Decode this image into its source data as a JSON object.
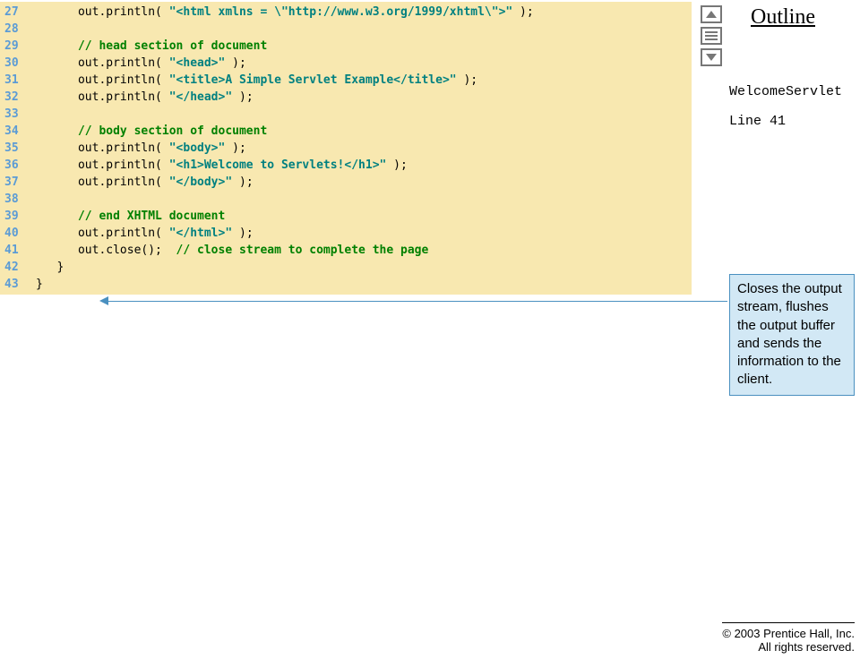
{
  "outline": {
    "title": "Outline",
    "class_name": "WelcomeServlet",
    "line_ref": "Line 41"
  },
  "callout": {
    "text": "Closes the output stream, flushes the output buffer and sends the information to the client."
  },
  "footer": {
    "line1": "© 2003 Prentice Hall, Inc.",
    "line2": "All rights reserved."
  },
  "code": {
    "lines": [
      {
        "n": "27",
        "seg": [
          {
            "c": "pln",
            "t": "      out.println( "
          },
          {
            "c": "str",
            "t": "\"<html xmlns = \\\"http://www.w3.org/1999/xhtml\\\">\""
          },
          {
            "c": "pln",
            "t": " );"
          }
        ]
      },
      {
        "n": "28",
        "seg": []
      },
      {
        "n": "29",
        "seg": [
          {
            "c": "pln",
            "t": "      "
          },
          {
            "c": "cmt",
            "t": "// head section of document"
          }
        ]
      },
      {
        "n": "30",
        "seg": [
          {
            "c": "pln",
            "t": "      out.println( "
          },
          {
            "c": "str",
            "t": "\"<head>\""
          },
          {
            "c": "pln",
            "t": " );"
          }
        ]
      },
      {
        "n": "31",
        "seg": [
          {
            "c": "pln",
            "t": "      out.println( "
          },
          {
            "c": "str",
            "t": "\"<title>A Simple Servlet Example</title>\""
          },
          {
            "c": "pln",
            "t": " );"
          }
        ]
      },
      {
        "n": "32",
        "seg": [
          {
            "c": "pln",
            "t": "      out.println( "
          },
          {
            "c": "str",
            "t": "\"</head>\""
          },
          {
            "c": "pln",
            "t": " );"
          }
        ]
      },
      {
        "n": "33",
        "seg": []
      },
      {
        "n": "34",
        "seg": [
          {
            "c": "pln",
            "t": "      "
          },
          {
            "c": "cmt",
            "t": "// body section of document"
          }
        ]
      },
      {
        "n": "35",
        "seg": [
          {
            "c": "pln",
            "t": "      out.println( "
          },
          {
            "c": "str",
            "t": "\"<body>\""
          },
          {
            "c": "pln",
            "t": " );"
          }
        ]
      },
      {
        "n": "36",
        "seg": [
          {
            "c": "pln",
            "t": "      out.println( "
          },
          {
            "c": "str",
            "t": "\"<h1>Welcome to Servlets!</h1>\""
          },
          {
            "c": "pln",
            "t": " );"
          }
        ]
      },
      {
        "n": "37",
        "seg": [
          {
            "c": "pln",
            "t": "      out.println( "
          },
          {
            "c": "str",
            "t": "\"</body>\""
          },
          {
            "c": "pln",
            "t": " );"
          }
        ]
      },
      {
        "n": "38",
        "seg": []
      },
      {
        "n": "39",
        "seg": [
          {
            "c": "pln",
            "t": "      "
          },
          {
            "c": "cmt",
            "t": "// end XHTML document"
          }
        ]
      },
      {
        "n": "40",
        "seg": [
          {
            "c": "pln",
            "t": "      out.println( "
          },
          {
            "c": "str",
            "t": "\"</html>\""
          },
          {
            "c": "pln",
            "t": " );"
          }
        ]
      },
      {
        "n": "41",
        "seg": [
          {
            "c": "pln",
            "t": "      out.close();  "
          },
          {
            "c": "cmt",
            "t": "// close stream to complete the page"
          }
        ]
      },
      {
        "n": "42",
        "seg": [
          {
            "c": "pln",
            "t": "   }"
          }
        ]
      },
      {
        "n": "43",
        "seg": [
          {
            "c": "pln",
            "t": "}"
          }
        ]
      }
    ]
  }
}
